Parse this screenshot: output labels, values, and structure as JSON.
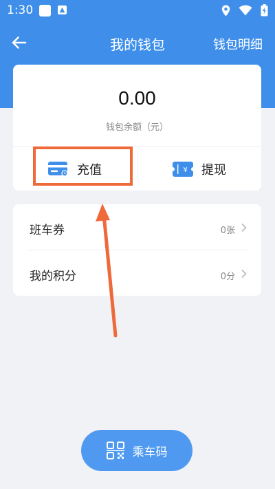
{
  "status_bar": {
    "time": "1:30",
    "icons": [
      "notification-square-icon",
      "a-badge-icon",
      "location-icon",
      "wifi-icon",
      "battery-icon"
    ]
  },
  "nav": {
    "title": "我的钱包",
    "right_action": "钱包明细",
    "back_icon": "back-arrow-icon"
  },
  "balance": {
    "amount": "0.00",
    "label": "钱包余额（元）"
  },
  "actions": {
    "recharge": {
      "label": "充值",
      "icon": "card-icon"
    },
    "withdraw": {
      "label": "提现",
      "icon": "yen-ticket-icon"
    }
  },
  "list": {
    "items": [
      {
        "label": "班车券",
        "value": "0张"
      },
      {
        "label": "我的积分",
        "value": "0分"
      }
    ]
  },
  "bottom_button": {
    "label": "乘车码",
    "icon": "qr-code-icon"
  },
  "colors": {
    "primary": "#3f8fea",
    "bottom_button": "#4f9af0",
    "annotation": "#ef6a3a",
    "background": "#f1f2f6"
  }
}
